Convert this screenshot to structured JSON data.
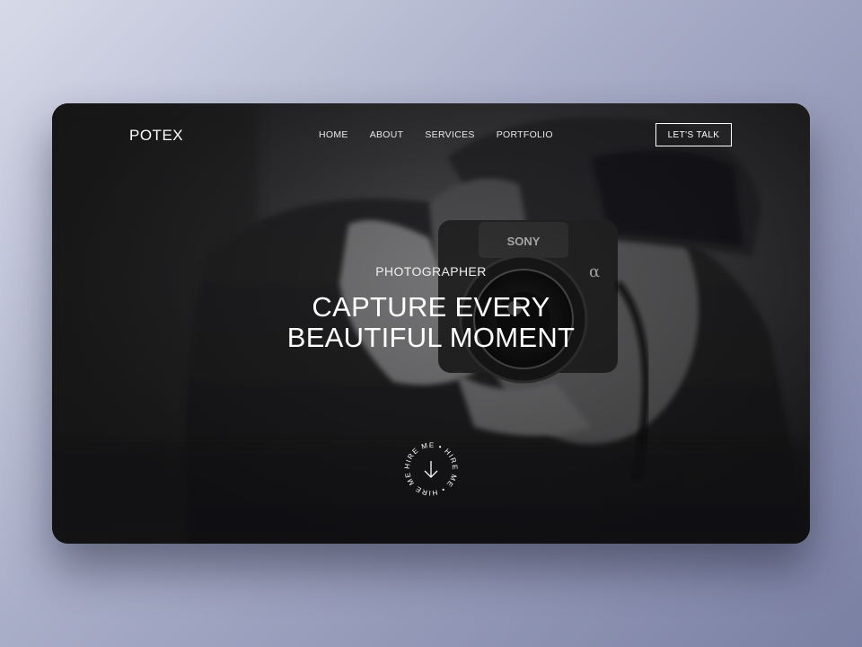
{
  "brand": {
    "logo": "POTEX"
  },
  "nav": {
    "items": [
      "HOME",
      "ABOUT",
      "SERVICES",
      "PORTFOLIO"
    ],
    "cta": "LET'S TALK"
  },
  "hero": {
    "eyebrow": "PHOTOGRAPHER",
    "headline_line1": "CAPTURE EVERY",
    "headline_line2": "BEAUTIFUL MOMENT",
    "badge_text": "HIRE ME • HIRE ME • HIRE ME •",
    "badge_icon": "arrow-down-icon"
  },
  "camera": {
    "brand": "SONY",
    "model_mark": "α"
  },
  "colors": {
    "text": "#ffffff",
    "card": "#2a2a2c"
  }
}
